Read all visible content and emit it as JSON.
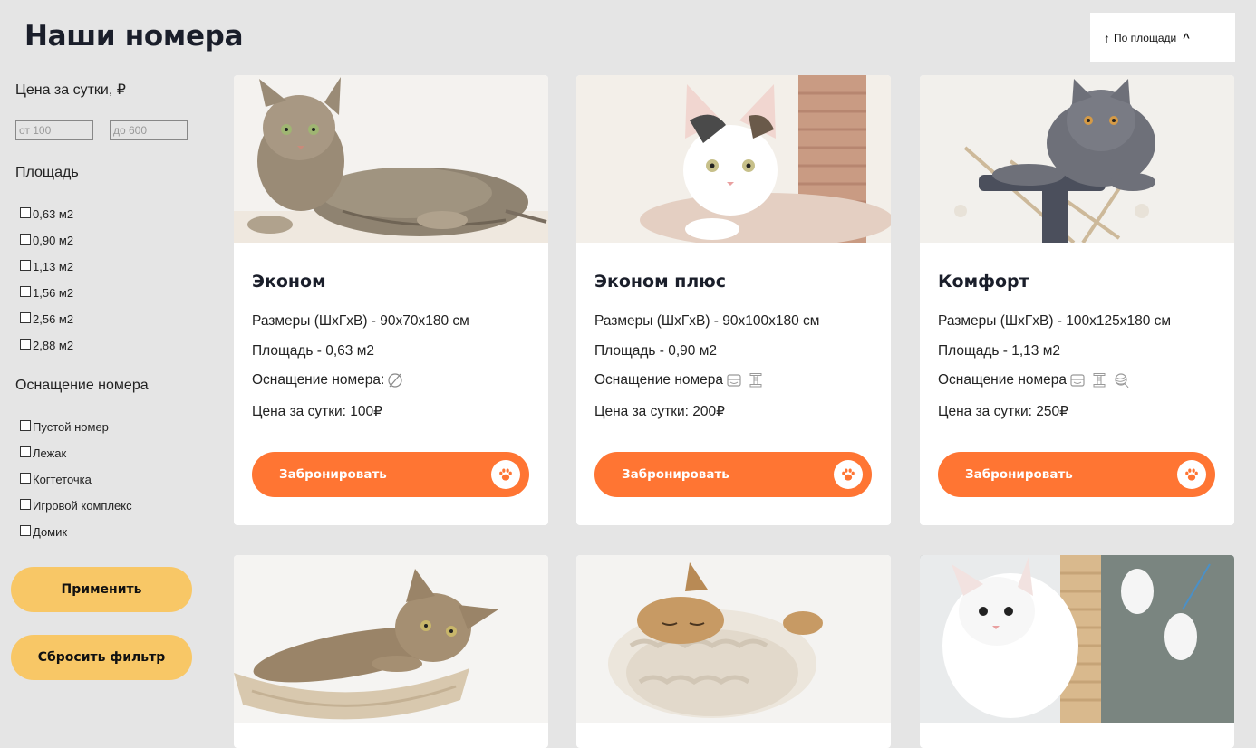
{
  "header": {
    "title": "Наши номера"
  },
  "sort": {
    "arrow": "↑",
    "label": "По площади",
    "caret": "^"
  },
  "filters": {
    "price_heading": "Цена за сутки, ₽",
    "price_from_placeholder": "от 100",
    "price_to_placeholder": "до 600",
    "area_heading": "Площадь",
    "area_options": [
      "0,63 м2",
      "0,90 м2",
      "1,13 м2",
      "1,56 м2",
      "2,56 м2",
      "2,88 м2"
    ],
    "equipment_heading": "Оснащение номера",
    "equipment_options": [
      "Пустой номер",
      "Лежак",
      "Когтеточка",
      "Игровой комплекс",
      "Домик"
    ],
    "apply_label": "Применить",
    "reset_label": "Сбросить фильтр"
  },
  "cards": [
    {
      "title": "Эконом",
      "size": "Размеры (ШхГхВ) - 90х70х180 см",
      "area": "Площадь - 0,63 м2",
      "equipment": "Оснащение номера:",
      "price": "Цена за сутки: 100₽",
      "book_label": "Забронировать",
      "icons": [
        "empty-icon"
      ]
    },
    {
      "title": "Эконом плюс",
      "size": "Размеры (ШхГхВ) - 90х100х180 см",
      "area": "Площадь - 0,90 м2",
      "equipment": "Оснащение номера",
      "price": "Цена за сутки: 200₽",
      "book_label": "Забронировать",
      "icons": [
        "bed-icon",
        "scratcher-icon"
      ]
    },
    {
      "title": "Комфорт",
      "size": "Размеры (ШхГхВ) - 100х125х180 см",
      "area": "Площадь - 1,13 м2",
      "equipment": "Оснащение номера",
      "price": "Цена за сутки: 250₽",
      "book_label": "Забронировать",
      "icons": [
        "bed-icon",
        "scratcher-icon",
        "yarn-ball-icon"
      ]
    }
  ],
  "colors": {
    "accent": "#ff7533",
    "filter_button": "#f8c766",
    "background": "#e5e5e5"
  }
}
